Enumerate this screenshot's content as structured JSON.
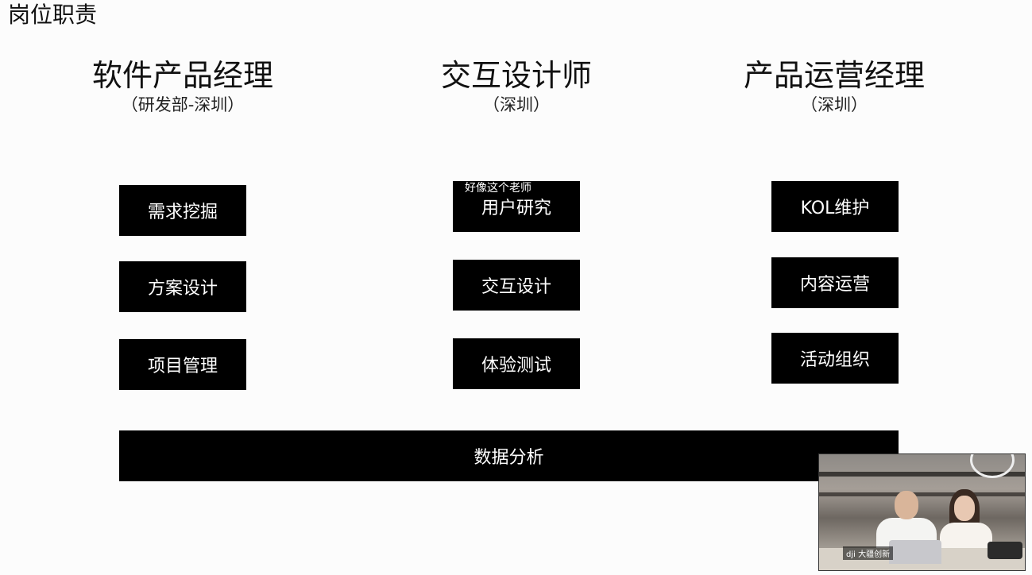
{
  "page": {
    "title": "岗位职责"
  },
  "columns": [
    {
      "role": "软件产品经理",
      "location": "（研发部-深圳）",
      "tasks": [
        "需求挖掘",
        "方案设计",
        "项目管理"
      ]
    },
    {
      "role": "交互设计师",
      "location": "（深圳）",
      "tasks": [
        "用户研究",
        "交互设计",
        "体验测试"
      ],
      "subtitle": "好像这个老师"
    },
    {
      "role": "产品运营经理",
      "location": "（深圳）",
      "tasks": [
        "KOL维护",
        "内容运营",
        "活动组织"
      ]
    }
  ],
  "shared_task": "数据分析",
  "video_overlay": {
    "brand_label": "dji 大疆创新"
  },
  "colors": {
    "box_bg": "#000000",
    "box_text": "#ffffff",
    "page_bg": "#fcfcfc"
  }
}
